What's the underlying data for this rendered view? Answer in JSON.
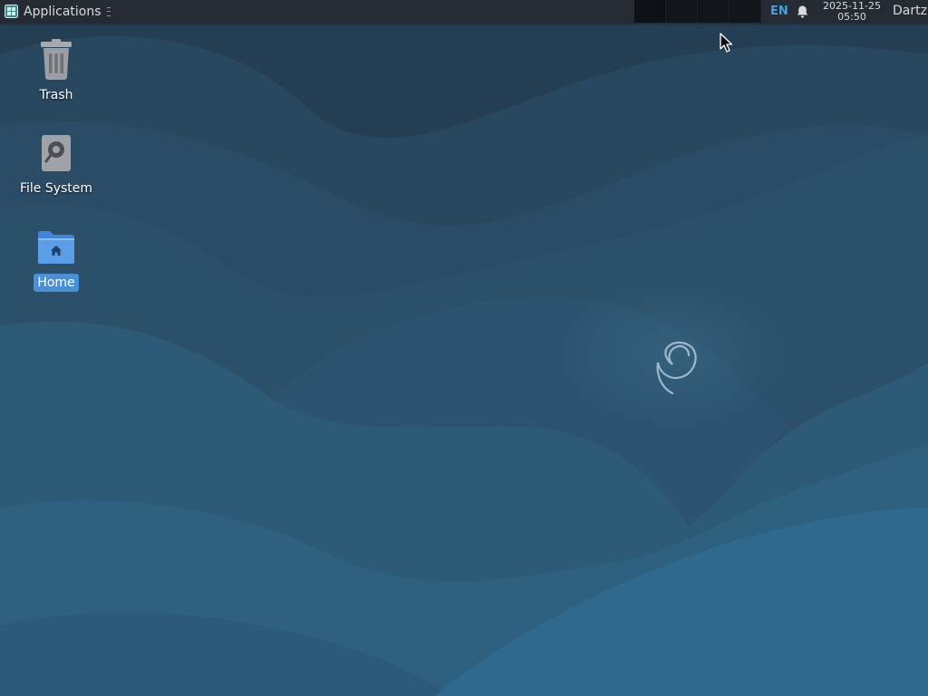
{
  "panel": {
    "applications_label": "Applications",
    "language": "EN",
    "date": "2025-11-25",
    "time": "05:50",
    "user": "Dartz"
  },
  "desktop": {
    "icons": [
      {
        "label": "Trash",
        "icon": "trash-icon"
      },
      {
        "label": "File System",
        "icon": "drive-icon"
      },
      {
        "label": "Home",
        "icon": "home-folder-icon",
        "selected": true
      }
    ]
  },
  "colors": {
    "panel_bg": "#262b33",
    "selection": "#4a90d9",
    "wallpaper_base": "#2a4d66"
  }
}
